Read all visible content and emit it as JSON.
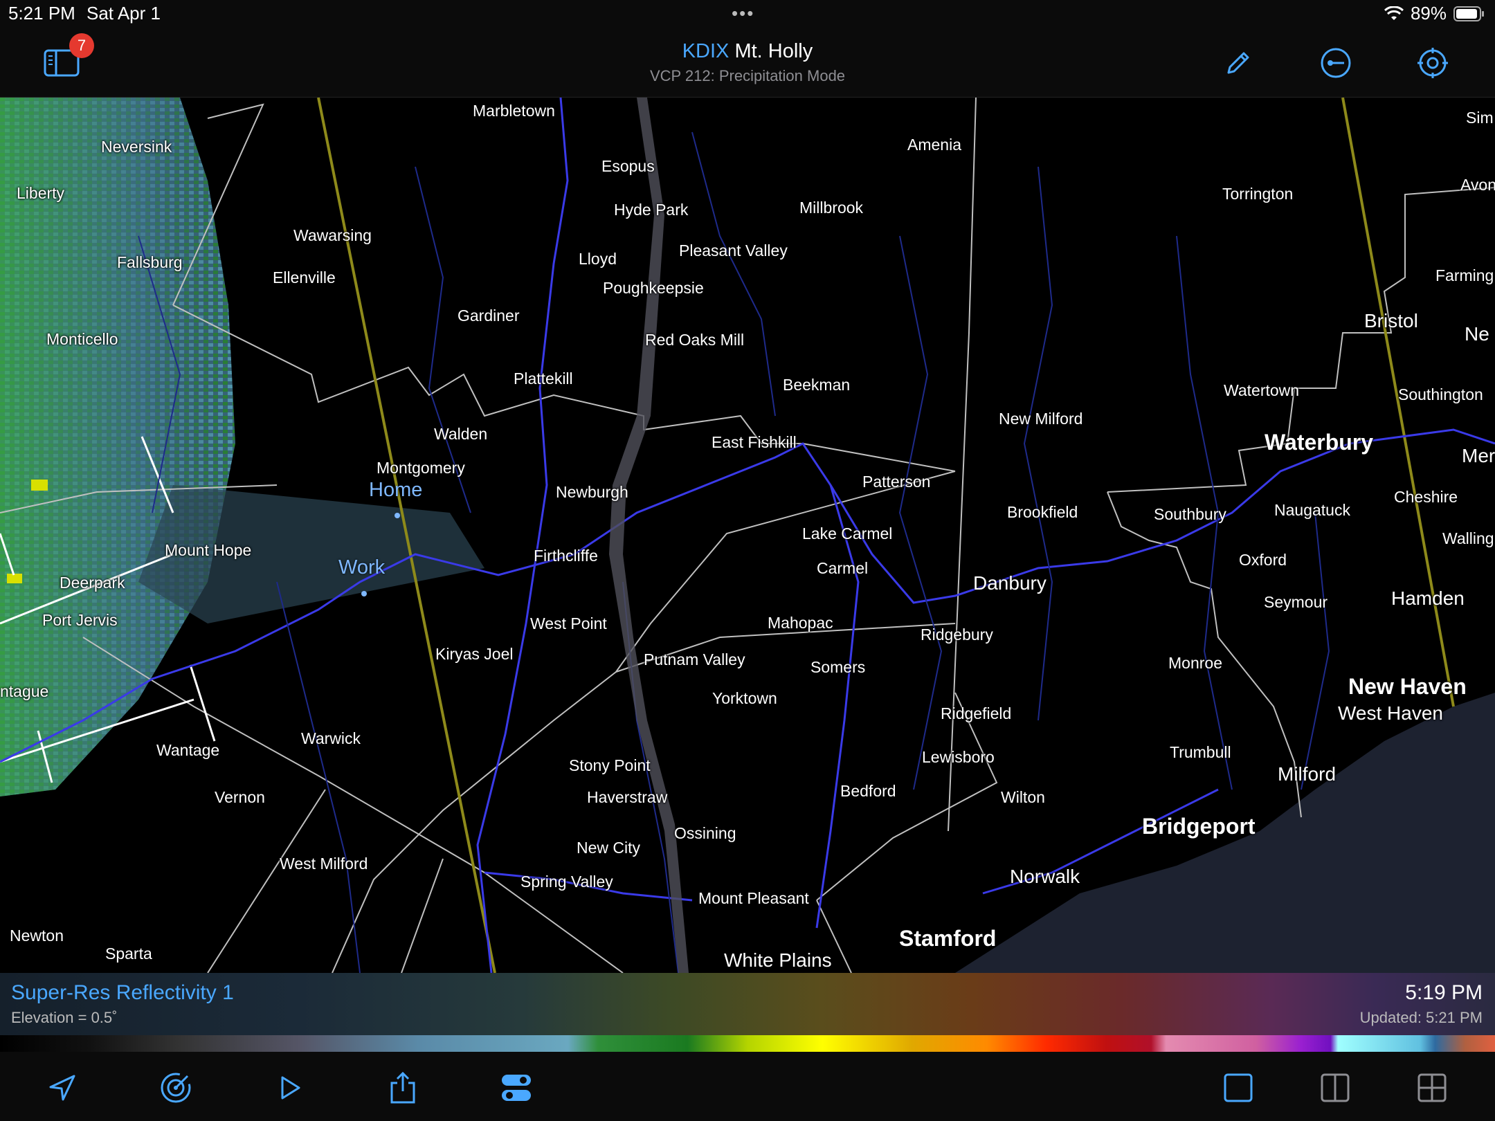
{
  "status_bar": {
    "time": "5:21 PM",
    "date": "Sat Apr 1",
    "battery": "89%",
    "multitask_dots": "•••"
  },
  "toolbar": {
    "sidebar_badge": "7",
    "station_id": "KDIX",
    "station_name": "Mt. Holly",
    "mode": "VCP 212: Precipitation Mode",
    "icons": [
      "sidebar-icon",
      "pencil-icon",
      "measure-icon",
      "crosshair-icon"
    ]
  },
  "map": {
    "favorites": [
      {
        "label": "Home"
      },
      {
        "label": "Work"
      }
    ],
    "cities": [
      "Marbletown",
      "Esopus",
      "Amenia",
      "Sim",
      "Neversink",
      "Liberty",
      "Hyde Park",
      "Millbrook",
      "Torrington",
      "Avon",
      "Wawarsing",
      "Fallsburg",
      "Lloyd",
      "Pleasant Valley",
      "Farming",
      "Ellenville",
      "Poughkeepsie",
      "Gardiner",
      "Bristol",
      "Ne",
      "Monticello",
      "Red Oaks Mill",
      "Plattekill",
      "Beekman",
      "Watertown",
      "Southington",
      "New Milford",
      "Walden",
      "East Fishkill",
      "Waterbury",
      "Mer",
      "Montgomery",
      "Patterson",
      "Cheshire",
      "Newburgh",
      "Brookfield",
      "Southbury",
      "Naugatuck",
      "Mount Hope",
      "Lake Carmel",
      "Walling",
      "Firthcliffe",
      "Oxford",
      "Deerpark",
      "Carmel",
      "Danbury",
      "Seymour",
      "Hamden",
      "Port Jervis",
      "Mahopac",
      "Ridgebury",
      "West Point",
      "Kiryas Joel",
      "Putnam Valley",
      "Somers",
      "Monroe",
      "New Haven",
      "ntague",
      "Yorktown",
      "Ridgefield",
      "West Haven",
      "Wantage",
      "Warwick",
      "Lewisboro",
      "Trumbull",
      "Stony Point",
      "Bedford",
      "Milford",
      "Vernon",
      "Haverstraw",
      "Wilton",
      "Ossining",
      "Bridgeport",
      "New City",
      "West Milford",
      "Spring Valley",
      "Norwalk",
      "Mount Pleasant",
      "Newton",
      "Sparta",
      "Stamford",
      "White Plains"
    ]
  },
  "info_bar": {
    "product": "Super-Res Reflectivity 1",
    "elevation": "Elevation = 0.5˚",
    "scan_time": "5:19 PM",
    "updated": "Updated: 5:21 PM"
  },
  "bottom_bar": {
    "icons": [
      "location-arrow-icon",
      "radar-icon",
      "play-icon",
      "share-icon",
      "layers-toggle-icon",
      "single-pane-icon",
      "two-pane-icon",
      "four-pane-icon"
    ]
  }
}
